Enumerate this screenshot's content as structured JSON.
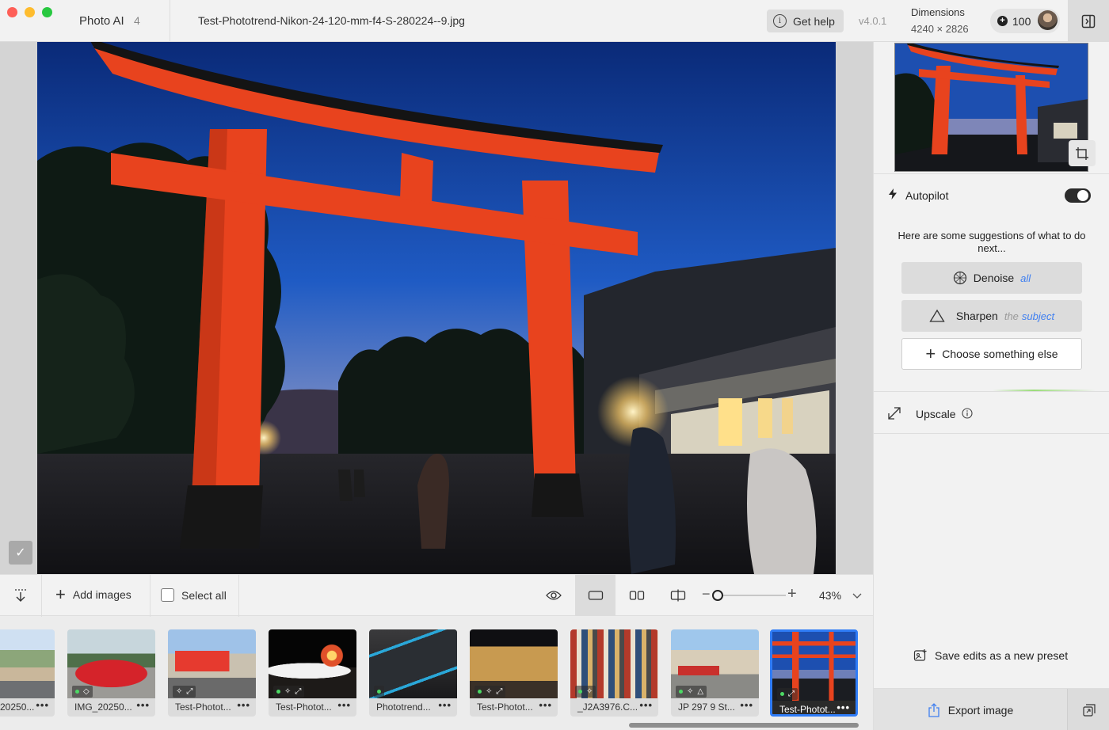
{
  "titlebar": {
    "app_name": "Photo AI",
    "app_count": "4",
    "filename": "Test-Phototrend-Nikon-24-120-mm-f4-S-280224--9.jpg",
    "help_label": "Get help",
    "version": "v4.0.1",
    "dimensions_label": "Dimensions",
    "dimensions_value": "4240 × 2826",
    "credits": "100"
  },
  "toolbar": {
    "add_images_label": "Add images",
    "select_all_label": "Select all",
    "zoom_value": "43%",
    "zoom_level_fraction": 0.05
  },
  "filmstrip": {
    "items": [
      {
        "label": "20250..."
      },
      {
        "label": "IMG_20250..."
      },
      {
        "label": "Test-Photot..."
      },
      {
        "label": "Test-Photot..."
      },
      {
        "label": "Phototrend..."
      },
      {
        "label": "Test-Photot..."
      },
      {
        "label": "_J2A3976.C..."
      },
      {
        "label": "JP 297 9 St..."
      },
      {
        "label": "Test-Photot..."
      }
    ],
    "more_glyph": "•••"
  },
  "panel": {
    "autopilot_label": "Autopilot",
    "autopilot_on": true,
    "suggestion_text": "Here are some suggestions of what to do next...",
    "denoise": {
      "label": "Denoise",
      "hint": "all"
    },
    "sharpen": {
      "label": "Sharpen",
      "hint_prefix": "the",
      "hint": "subject"
    },
    "choose_else_label": "Choose something else",
    "upscale_label": "Upscale",
    "save_preset_label": "Save edits as a new preset",
    "export_label": "Export image"
  },
  "colors": {
    "accent_blue": "#2f7cf6",
    "torii_orange": "#e8431e",
    "green_indicator": "#4cd964"
  }
}
